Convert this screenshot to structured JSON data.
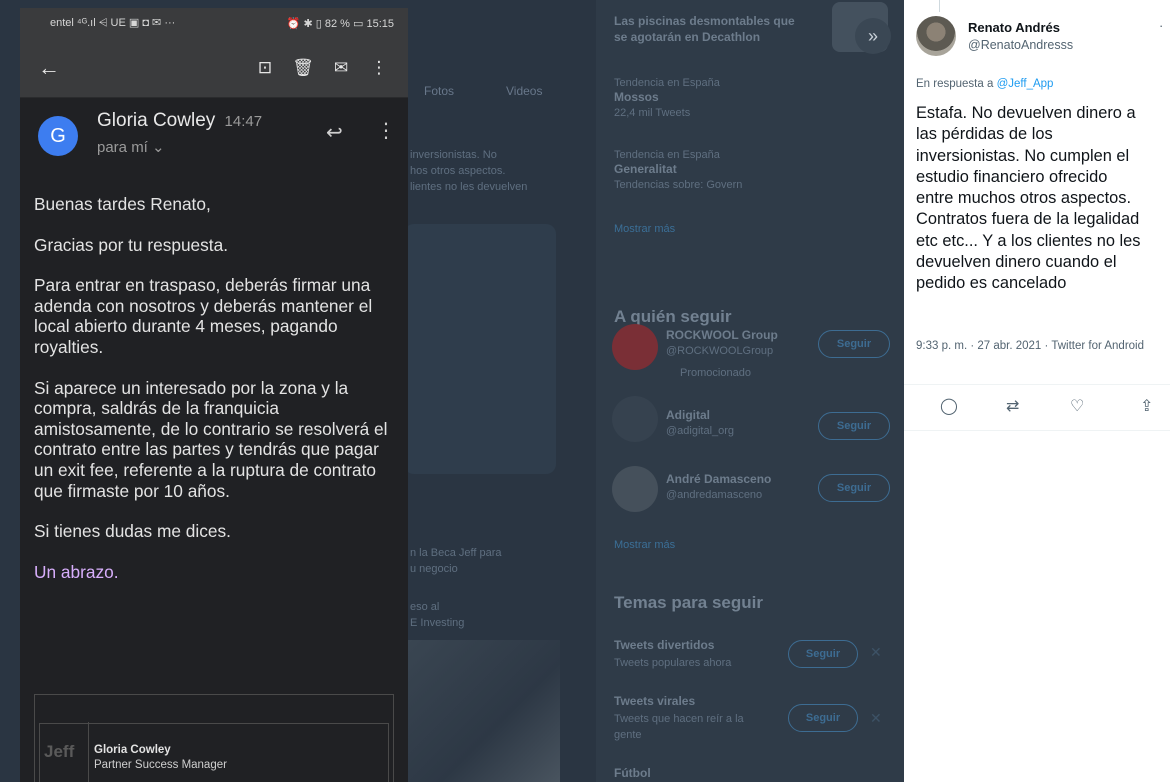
{
  "background": {
    "top_card": {
      "line1": "Las piscinas desmontables que",
      "line2": "se agotarán en Decathlon"
    },
    "tabs": [
      "Fotos",
      "Videos"
    ],
    "trends": [
      {
        "context": "Tendencia en España",
        "name": "Mossos",
        "count": "22,4 mil Tweets"
      },
      {
        "context": "Tendencia en España",
        "name": "Generalitat",
        "count": "Tendencias sobre: Govern"
      }
    ],
    "show_more_1": "Mostrar más",
    "who_to_follow": "A quién seguir",
    "follow_suggestions": [
      {
        "name": "ROCKWOOL Group",
        "handle": "@ROCKWOOLGroup",
        "promo": "Promocionado"
      },
      {
        "name": "Adigital",
        "handle": "@adigital_org"
      },
      {
        "name": "André Damasceno",
        "handle": "@andredamasceno"
      }
    ],
    "show_more_2": "Mostrar más",
    "topics_header": "Temas para seguir",
    "topics": [
      {
        "name": "Tweets divertidos",
        "desc": "Tweets populares ahora"
      },
      {
        "name": "Tweets virales",
        "desc": "Tweets que hacen reír a la",
        "desc2": "gente"
      },
      {
        "name": "Fútbol"
      }
    ],
    "follow_label": "Seguir",
    "left_snippets": {
      "line_a": "inversionistas. No",
      "line_b": "hos otros aspectos.",
      "line_c": "lientes no les devuelven",
      "line_d": "n la Beca Jeff para",
      "line_e": "u negocio",
      "line_f": "eso al",
      "line_g": "E Investing"
    },
    "expand_icon": "chevron-double-right-icon"
  },
  "phone": {
    "status_left": "entel ⁴ᴳ.ıl ⩤ UE ▣ ◘ ✉ ···",
    "status_right": "⏰ ✱ ▯ 82 % ▭ 15:15",
    "sender": {
      "initial": "G",
      "name": "Gloria Cowley",
      "time": "14:47",
      "to": "para mí ⌄"
    },
    "greeting": "Buenas tardes Renato,",
    "paragraphs": [
      "Gracias por tu respuesta.",
      "Para entrar en traspaso, deberás firmar una adenda con nosotros y deberás mantener el local abierto durante 4 meses, pagando royalties.",
      "Si aparece un interesado por la zona y la compra, saldrás de la franquicia amistosamente, de lo contrario se resolverá el contrato entre las partes y tendrás que pagar un exit fee, referente a la ruptura de contrato que firmaste por 10 años.",
      "Si tienes dudas me dices."
    ],
    "closing": "Un abrazo.",
    "signature": {
      "logo": "Jeff",
      "name": "Gloria Cowley",
      "role": "Partner Success Manager"
    }
  },
  "tweet": {
    "name": "Renato Andrés",
    "handle": "@RenatoAndresss",
    "reply_prefix": "En respuesta a ",
    "reply_to": "@Jeff_App",
    "text": "Estafa. No devuelven dinero a\nlas pérdidas de los\ninversionistas. No cumplen el\nestudio financiero ofrecido\nentre muchos otros aspectos.\nContratos fuera de la legalidad\netc etc... Y a los clientes no les\ndevuelven dinero cuando el\npedido es cancelado",
    "meta": "9:33 p. m. · 27 abr. 2021 · Twitter for Android",
    "actions": [
      "reply-icon",
      "retweet-icon",
      "like-icon",
      "share-icon"
    ]
  }
}
